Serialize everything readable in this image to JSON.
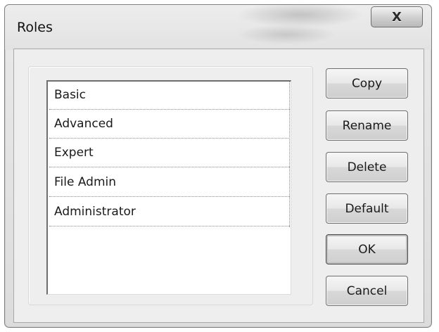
{
  "window": {
    "title": "Roles",
    "close_label": "X"
  },
  "roles_list": {
    "items": [
      {
        "label": "Basic"
      },
      {
        "label": "Advanced"
      },
      {
        "label": "Expert"
      },
      {
        "label": "File Admin"
      },
      {
        "label": "Administrator"
      }
    ]
  },
  "buttons": {
    "copy": "Copy",
    "rename": "Rename",
    "delete": "Delete",
    "default": "Default",
    "ok": "OK",
    "cancel": "Cancel"
  }
}
